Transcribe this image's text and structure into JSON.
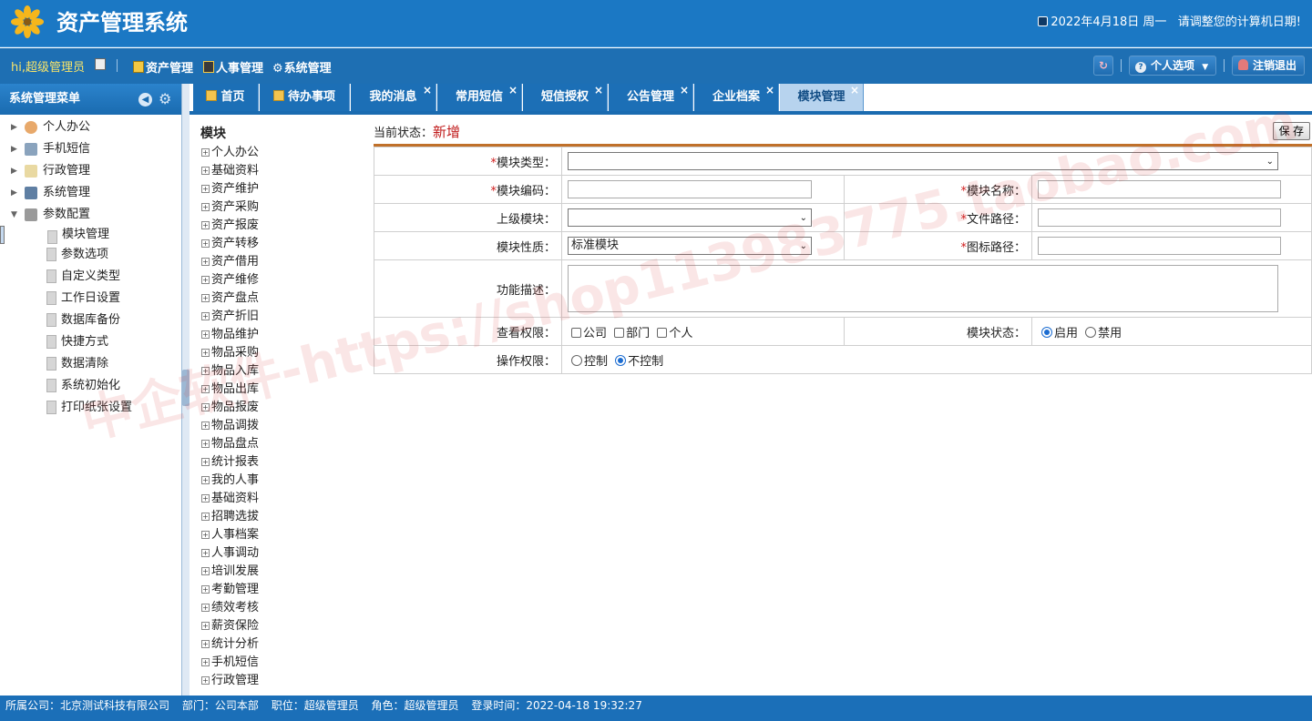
{
  "header": {
    "title": "资产管理系统",
    "date": "2022年4月18日 周一",
    "notice": "请调整您的计算机日期!"
  },
  "topbar": {
    "greeting": "hi,超级管理员",
    "nav": [
      "资产管理",
      "人事管理",
      "系统管理"
    ],
    "personal_label": "个人选项",
    "logout_label": "注销退出"
  },
  "sidebar": {
    "title": "系统管理菜单",
    "items": [
      {
        "label": "个人办公"
      },
      {
        "label": "手机短信"
      },
      {
        "label": "行政管理"
      },
      {
        "label": "系统管理"
      },
      {
        "label": "参数配置"
      }
    ],
    "subitems": [
      {
        "label": "模块管理"
      },
      {
        "label": "参数选项"
      },
      {
        "label": "自定义类型"
      },
      {
        "label": "工作日设置"
      },
      {
        "label": "数据库备份"
      },
      {
        "label": "快捷方式"
      },
      {
        "label": "数据清除"
      },
      {
        "label": "系统初始化"
      },
      {
        "label": "打印纸张设置"
      }
    ]
  },
  "tabs": [
    {
      "label": "首页"
    },
    {
      "label": "待办事项"
    },
    {
      "label": "我的消息"
    },
    {
      "label": "常用短信"
    },
    {
      "label": "短信授权"
    },
    {
      "label": "公告管理"
    },
    {
      "label": "企业档案"
    },
    {
      "label": "模块管理"
    }
  ],
  "tree": {
    "root": "模块",
    "items": [
      "个人办公",
      "基础资料",
      "资产维护",
      "资产采购",
      "资产报废",
      "资产转移",
      "资产借用",
      "资产维修",
      "资产盘点",
      "资产折旧",
      "物品维护",
      "物品采购",
      "物品入库",
      "物品出库",
      "物品报废",
      "物品调拨",
      "物品盘点",
      "统计报表",
      "我的人事",
      "基础资料",
      "招聘选拔",
      "人事档案",
      "人事调动",
      "培训发展",
      "考勤管理",
      "绩效考核",
      "薪资保险",
      "统计分析",
      "手机短信",
      "行政管理"
    ]
  },
  "form": {
    "status_label": "当前状态：",
    "status_value": "新增",
    "save_label": "保 存",
    "module_type_label": "模块类型：",
    "module_code_label": "模块编码：",
    "module_name_label": "模块名称：",
    "parent_label": "上级模块：",
    "file_path_label": "文件路径：",
    "nature_label": "模块性质：",
    "nature_value": "标准模块",
    "icon_path_label": "图标路径：",
    "desc_label": "功能描述：",
    "view_label": "查看权限：",
    "view_options": [
      "公司",
      "部门",
      "个人"
    ],
    "state_label": "模块状态：",
    "state_options": [
      "启用",
      "禁用"
    ],
    "op_label": "操作权限：",
    "op_options": [
      "控制",
      "不控制"
    ]
  },
  "footer": {
    "company": "所属公司：北京测试科技有限公司",
    "dept": "部门：公司本部",
    "position": "职位：超级管理员",
    "role": "角色：超级管理员",
    "login": "登录时间：2022-04-18 19:32:27"
  },
  "watermark": "中企软件-https://shop113983775.taobao.com",
  "colors": {
    "primary": "#1b78c4",
    "accent": "#c0702a",
    "required": "#d01b1b"
  }
}
